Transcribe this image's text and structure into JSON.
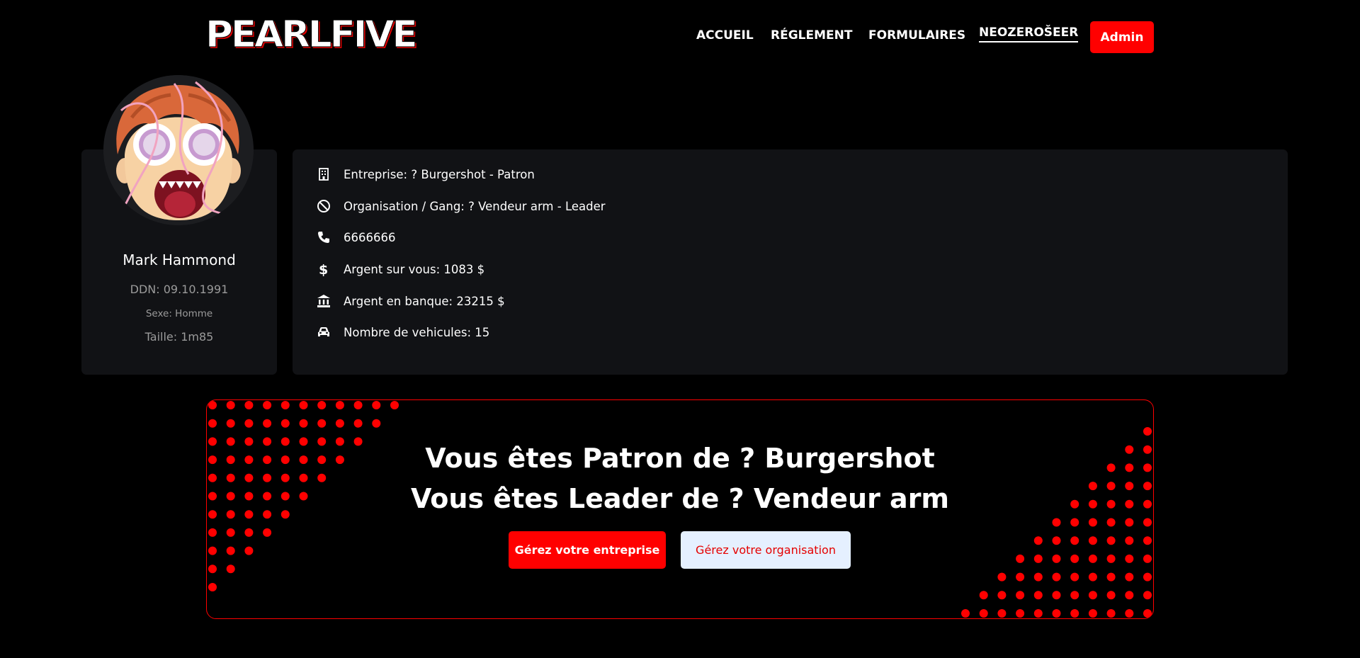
{
  "brand": {
    "logo_text": "PEARLFIVE"
  },
  "nav": {
    "items": [
      {
        "label": "ACCUEIL"
      },
      {
        "label": "RÉGLEMENT"
      },
      {
        "label": "FORMULAIRES"
      },
      {
        "label": "NEOZEROŠEER"
      }
    ],
    "admin_label": "Admin"
  },
  "profile": {
    "name": "Mark Hammond",
    "birth": "DDN: 09.10.1991",
    "sex": "Sexe: Homme",
    "height": "Taille: 1m85"
  },
  "details": [
    {
      "icon": "building-icon",
      "text": "Entreprise: ? Burgershot - Patron"
    },
    {
      "icon": "ban-icon",
      "text": "Organisation / Gang: ? Vendeur arm - Leader"
    },
    {
      "icon": "phone-icon",
      "text": "6666666"
    },
    {
      "icon": "dollar-icon",
      "text": "Argent sur vous: 1083 $"
    },
    {
      "icon": "bank-icon",
      "text": "Argent en banque: 23215 $"
    },
    {
      "icon": "car-icon",
      "text": "Nombre de vehicules: 15"
    }
  ],
  "banner": {
    "line1": "Vous êtes Patron de ? Burgershot",
    "line2": "Vous êtes Leader de ? Vendeur arm",
    "btn_company": "Gérez votre entreprise",
    "btn_org": "Gérez votre organisation"
  },
  "colors": {
    "accent": "#ff0000",
    "card_bg": "#111215",
    "page_bg": "#000000",
    "light_button_bg": "#e5f0ff"
  }
}
